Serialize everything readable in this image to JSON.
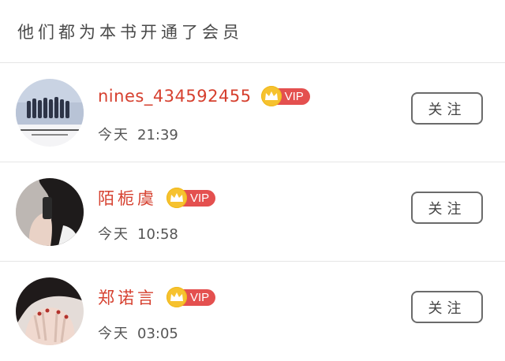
{
  "header": {
    "title": "他们都为本书开通了会员"
  },
  "vip_label": "VIP",
  "colors": {
    "username": "#d6402f",
    "vip_badge": "#e4504f",
    "crown": "#f6c22f"
  },
  "members": [
    {
      "username": "nines_434592455",
      "time_prefix": "今天",
      "time": "21:39",
      "follow_label": "关注"
    },
    {
      "username": "陌栀虞",
      "time_prefix": "今天",
      "time": "10:58",
      "follow_label": "关注"
    },
    {
      "username": "郑诺言",
      "time_prefix": "今天",
      "time": "03:05",
      "follow_label": "关注"
    }
  ]
}
